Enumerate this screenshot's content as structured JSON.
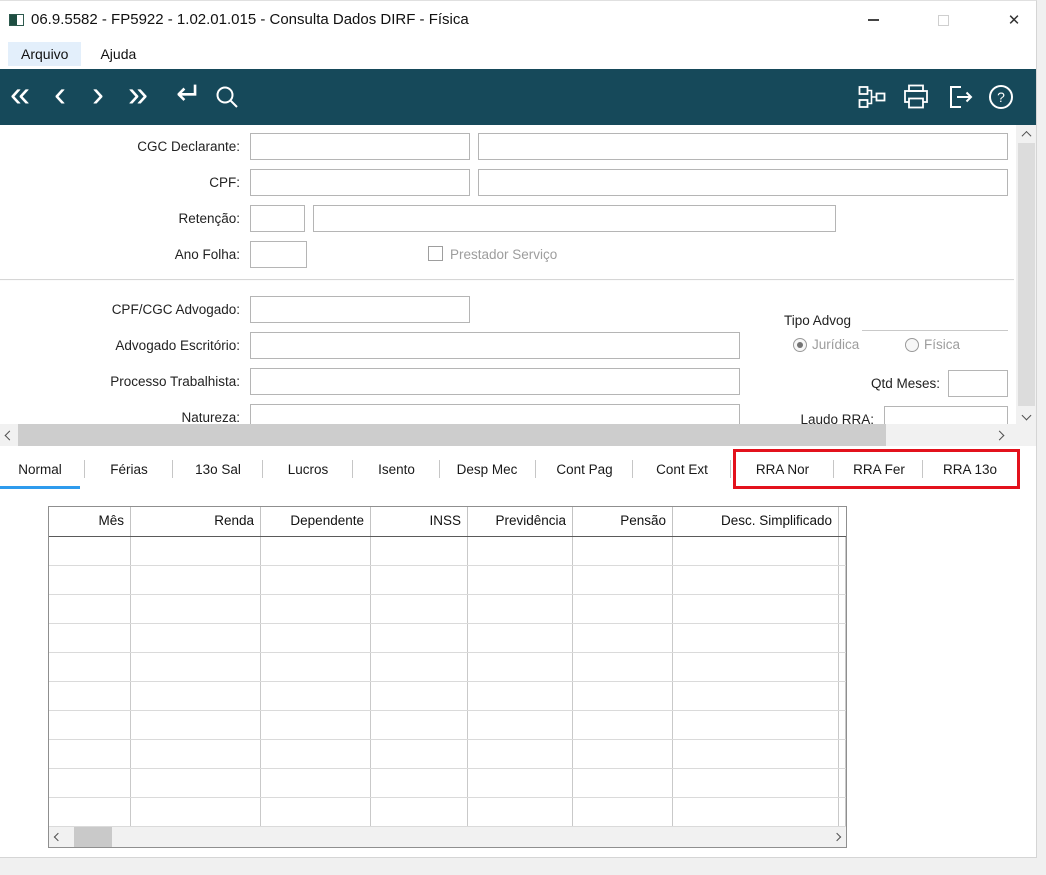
{
  "window": {
    "title": "06.9.5582 - FP5922 - 1.02.01.015 - Consulta Dados DIRF - Física",
    "close_glyph": "✕"
  },
  "menu": {
    "arquivo": "Arquivo",
    "ajuda": "Ajuda"
  },
  "toolbar": {
    "first_glyph": "«",
    "prev_glyph": "‹",
    "next_glyph": "›",
    "last_glyph": "»",
    "enter_glyph": "↵",
    "help_glyph": "?"
  },
  "form": {
    "cgc_declarante_label": "CGC Declarante:",
    "cpf_label": "CPF:",
    "retencao_label": "Retenção:",
    "ano_folha_label": "Ano Folha:",
    "prestador_servico_label": "Prestador Serviço",
    "cpf_cgc_advogado_label": "CPF/CGC Advogado:",
    "advogado_escritorio_label": "Advogado Escritório:",
    "processo_trabalhista_label": "Processo Trabalhista:",
    "natureza_label": "Natureza:",
    "tipo_advog_label": "Tipo Advog",
    "tipo_advog_options": [
      "Jurídica",
      "Física"
    ],
    "tipo_advog_selected": "Jurídica",
    "qtd_meses_label": "Qtd Meses:",
    "laudo_rra_label": "Laudo RRA:",
    "values": {
      "cgc_declarante": "",
      "cgc_declarante_desc": "",
      "cpf": "",
      "cpf_desc": "",
      "retencao": "",
      "retencao_desc": "",
      "ano_folha": "",
      "prestador_servico_checked": false,
      "cpf_cgc_advogado": "",
      "advogado_escritorio": "",
      "processo_trabalhista": "",
      "natureza": "",
      "qtd_meses": "",
      "laudo_rra": ""
    }
  },
  "tabs": {
    "items": [
      "Normal",
      "Férias",
      "13o Sal",
      "Lucros",
      "Isento",
      "Desp Mec",
      "Cont Pag",
      "Cont Ext",
      "RRA Nor",
      "RRA Fer",
      "RRA 13o"
    ],
    "active": "Normal",
    "highlighted": [
      "RRA Nor",
      "RRA Fer",
      "RRA 13o"
    ]
  },
  "table": {
    "columns": [
      "Mês",
      "Renda",
      "Dependente",
      "INSS",
      "Previdência",
      "Pensão",
      "Desc. Simplificado"
    ],
    "rows": [],
    "empty_row_count": 10
  },
  "colors": {
    "toolbar_bg": "#16495A",
    "tab_active_underline": "#2E9BED",
    "highlight_box": "#E3111C"
  }
}
